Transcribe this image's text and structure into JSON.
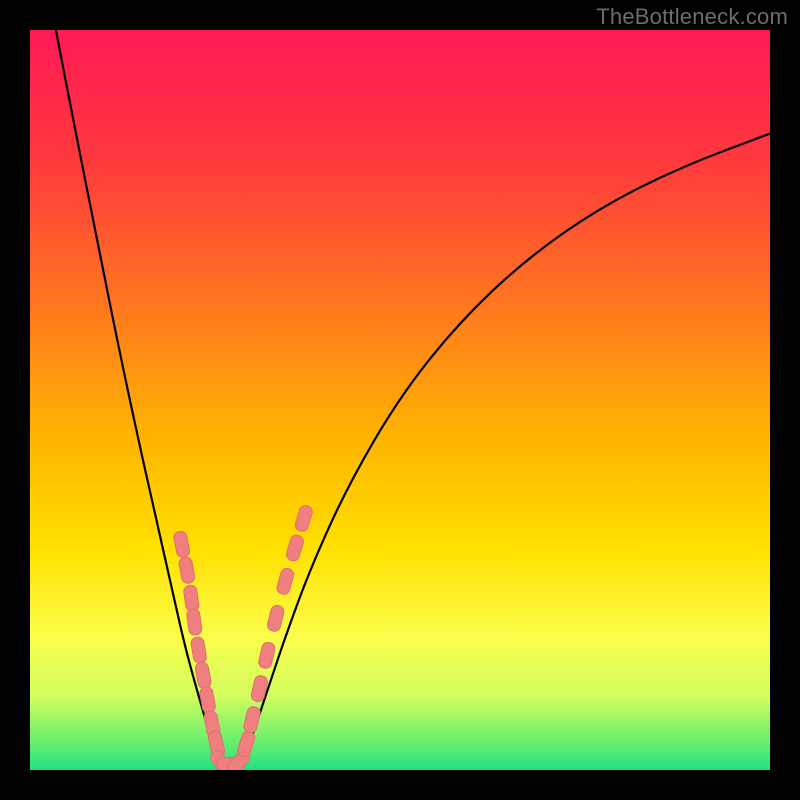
{
  "watermark": "TheBottleneck.com",
  "colors": {
    "frame": "#000000",
    "curve": "#000000",
    "marker_fill": "#f08080",
    "marker_stroke": "#e36d6d",
    "gradient_stops": [
      {
        "pct": 0,
        "color": "#ff1a55"
      },
      {
        "pct": 18,
        "color": "#ff3a3c"
      },
      {
        "pct": 38,
        "color": "#ff7a1e"
      },
      {
        "pct": 55,
        "color": "#ffb400"
      },
      {
        "pct": 70,
        "color": "#ffe000"
      },
      {
        "pct": 82,
        "color": "#fafe4a"
      },
      {
        "pct": 90,
        "color": "#d2fd5e"
      },
      {
        "pct": 96,
        "color": "#6cf06c"
      },
      {
        "pct": 100,
        "color": "#22e080"
      }
    ]
  },
  "chart_data": {
    "type": "line",
    "title": "",
    "xlabel": "",
    "ylabel": "",
    "xunits": "fraction of plot width (0=left, 1=right)",
    "yunits": "fraction of plot height (0=bottom, 1=top)",
    "xlim": [
      0,
      1
    ],
    "ylim": [
      0,
      1
    ],
    "series": [
      {
        "name": "left-branch",
        "x": [
          0.035,
          0.06,
          0.09,
          0.12,
          0.15,
          0.175,
          0.195,
          0.21,
          0.225,
          0.238,
          0.248,
          0.255
        ],
        "y": [
          1.0,
          0.87,
          0.72,
          0.57,
          0.43,
          0.32,
          0.23,
          0.165,
          0.11,
          0.065,
          0.03,
          0.01
        ]
      },
      {
        "name": "right-branch",
        "x": [
          0.285,
          0.3,
          0.32,
          0.345,
          0.38,
          0.43,
          0.5,
          0.58,
          0.67,
          0.77,
          0.88,
          1.0
        ],
        "y": [
          0.01,
          0.045,
          0.105,
          0.18,
          0.275,
          0.385,
          0.505,
          0.605,
          0.69,
          0.76,
          0.815,
          0.86
        ]
      },
      {
        "name": "valley-floor",
        "x": [
          0.255,
          0.285
        ],
        "y": [
          0.005,
          0.005
        ]
      }
    ],
    "markers": {
      "note": "lozenge-shaped clusters along both branches near valley",
      "points": [
        {
          "branch": "left",
          "x": 0.205,
          "y": 0.305
        },
        {
          "branch": "left",
          "x": 0.212,
          "y": 0.27
        },
        {
          "branch": "left",
          "x": 0.218,
          "y": 0.232
        },
        {
          "branch": "left",
          "x": 0.222,
          "y": 0.2
        },
        {
          "branch": "left",
          "x": 0.228,
          "y": 0.162
        },
        {
          "branch": "left",
          "x": 0.234,
          "y": 0.128
        },
        {
          "branch": "left",
          "x": 0.24,
          "y": 0.095
        },
        {
          "branch": "left",
          "x": 0.246,
          "y": 0.062
        },
        {
          "branch": "left",
          "x": 0.252,
          "y": 0.035
        },
        {
          "branch": "floor",
          "x": 0.258,
          "y": 0.01
        },
        {
          "branch": "floor",
          "x": 0.27,
          "y": 0.008
        },
        {
          "branch": "floor",
          "x": 0.282,
          "y": 0.01
        },
        {
          "branch": "right",
          "x": 0.292,
          "y": 0.035
        },
        {
          "branch": "right",
          "x": 0.3,
          "y": 0.068
        },
        {
          "branch": "right",
          "x": 0.31,
          "y": 0.11
        },
        {
          "branch": "right",
          "x": 0.32,
          "y": 0.155
        },
        {
          "branch": "right",
          "x": 0.332,
          "y": 0.205
        },
        {
          "branch": "right",
          "x": 0.345,
          "y": 0.255
        },
        {
          "branch": "right",
          "x": 0.358,
          "y": 0.3
        },
        {
          "branch": "right",
          "x": 0.37,
          "y": 0.34
        }
      ]
    }
  }
}
